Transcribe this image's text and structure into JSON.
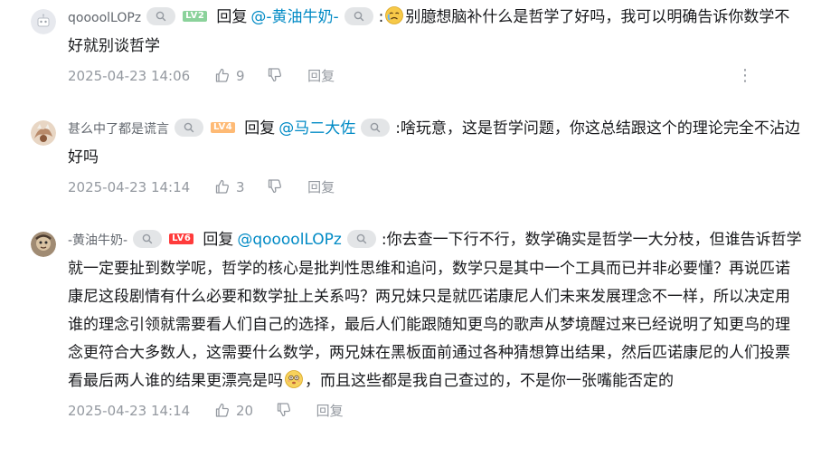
{
  "comments": [
    {
      "username": "qoooolLOPz",
      "level": "LV2",
      "reply_word": "回复",
      "reply_to": "@-黄油牛奶-",
      "text_before": ":",
      "text_after": "别臆想脑补什么是哲学了好吗，我可以明确告诉你数学不好就别谈哲学",
      "time": "2025-04-23 14:06",
      "likes": "9",
      "reply_label": "回复",
      "more_icon": "⋮",
      "avatar_color": "#e7e9ee",
      "emoji": "crying-face"
    },
    {
      "username": "甚么中了都是谎言",
      "level": "LV4",
      "reply_word": "回复",
      "reply_to": "@马二大佐",
      "text": ":啥玩意，这是哲学问题，你这总结跟这个的理论完全不沾边好吗",
      "time": "2025-04-23 14:14",
      "likes": "3",
      "reply_label": "回复",
      "avatar_color": "#c9a58b"
    },
    {
      "username": "-黄油牛奶-",
      "level": "LV6",
      "reply_word": "回复",
      "reply_to": "@qoooolLOPz",
      "text_before": ":你去查一下行不行，数学确实是哲学一大分枝，但谁告诉哲学就一定要扯到数学呢，哲学的核心是批判性思维和追问，数学只是其中一个工具而已并非必要懂？再说匹诺康尼这段剧情有什么必要和数学扯上关系吗？两兄妹只是就匹诺康尼人们未来发展理念不一样，所以决定用谁的理念引领就需要看人们自己的选择，最后人们能跟随知更鸟的歌声从梦境醒过来已经说明了知更鸟的理念更符合大多数人，这需要什么数学，两兄妹在黑板面前通过各种猜想算出结果，然后匹诺康尼的人们投票看最后两人谁的结果更漂亮是吗",
      "text_after": "，而且这些都是我自己查过的，不是你一张嘴能否定的",
      "time": "2025-04-23 14:14",
      "likes": "20",
      "reply_label": "回复",
      "avatar_color": "#6b5a4a",
      "emoji": "dazed-face"
    }
  ]
}
